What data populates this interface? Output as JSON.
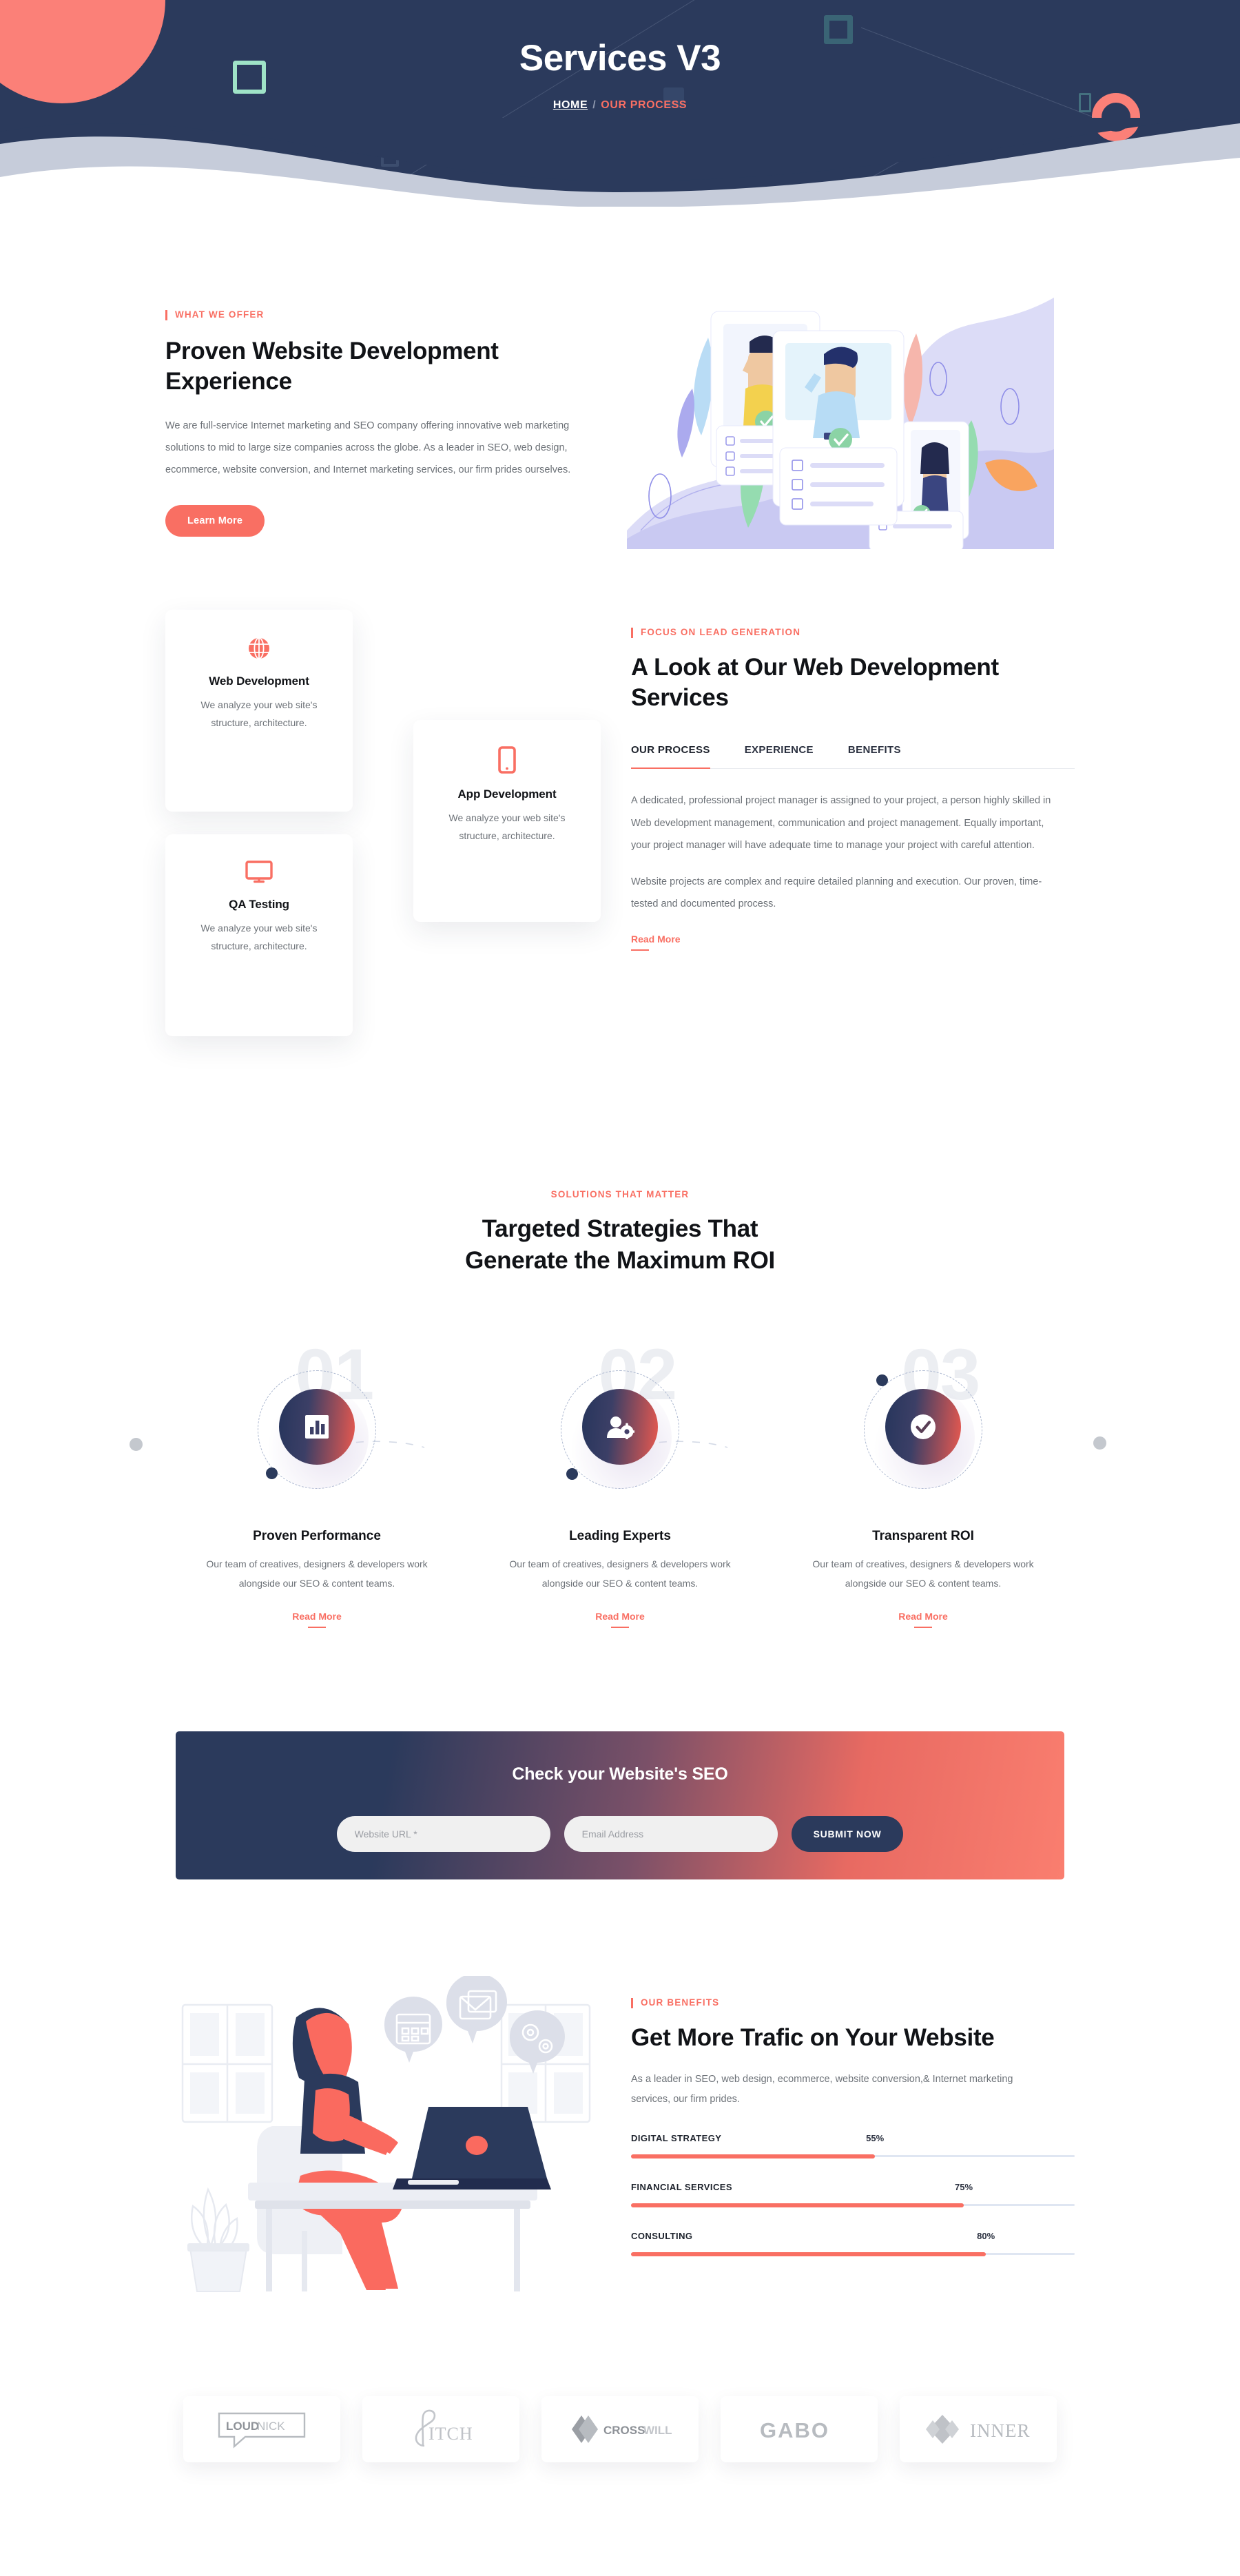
{
  "hero": {
    "title": "Services V3",
    "breadcrumb": {
      "home": "HOME",
      "separator": "/",
      "current": "OUR PROCESS"
    },
    "bg_color": "#2b3a5c",
    "accent_color": "#f96f63"
  },
  "offer": {
    "eyebrow": "WHAT WE OFFER",
    "title": "Proven Website Development Experience",
    "paragraph": "We are full-service Internet marketing and SEO company offering innovative web marketing solutions to mid to large size companies across the globe. As a leader in SEO, web design, ecommerce, website conversion, and Internet marketing services, our firm prides ourselves.",
    "button_label": "Learn More",
    "illustration_name": "profile-cards-illustration"
  },
  "services": {
    "cards": [
      {
        "icon": "globe-icon",
        "title": "Web Development",
        "text": "We analyze your web site's structure, architecture."
      },
      {
        "icon": "mobile-icon",
        "title": "App Development",
        "text": "We analyze your web site's structure, architecture."
      },
      {
        "icon": "monitor-icon",
        "title": "QA Testing",
        "text": "We analyze your web site's structure, architecture."
      }
    ],
    "eyebrow": "FOCUS ON LEAD GENERATION",
    "title": "A Look at Our Web Development Services",
    "tabs": [
      {
        "label": "OUR PROCESS",
        "active": true
      },
      {
        "label": "EXPERIENCE",
        "active": false
      },
      {
        "label": "BENEFITS",
        "active": false
      }
    ],
    "panel": {
      "paragraph1": "A dedicated, professional project manager is assigned to your project, a person highly skilled in Web development management, communication and project management. Equally important, your project manager will have adequate time to manage your project with careful attention.",
      "paragraph2": "Website projects are complex and require detailed planning and execution. Our proven, time-tested and documented process.",
      "read_more": "Read More"
    }
  },
  "steps_section": {
    "eyebrow": "SOLUTIONS THAT MATTER",
    "title_line1": "Targeted Strategies That",
    "title_line2": "Generate the Maximum ROI",
    "steps": [
      {
        "number": "01",
        "icon": "bar-chart-icon",
        "title": "Proven Performance",
        "text": "Our team of creatives, designers & developers work alongside our SEO & content teams.",
        "read_more": "Read More"
      },
      {
        "number": "02",
        "icon": "user-settings-icon",
        "title": "Leading Experts",
        "text": "Our team of creatives, designers & developers work alongside our SEO & content teams.",
        "read_more": "Read More"
      },
      {
        "number": "03",
        "icon": "check-circle-icon",
        "title": "Transparent ROI",
        "text": "Our team of creatives, designers & developers work alongside our SEO & content teams.",
        "read_more": "Read More"
      }
    ]
  },
  "seo_form": {
    "title": "Check your Website's SEO",
    "url_placeholder": "Website URL *",
    "email_placeholder": "Email Address",
    "url_value": "",
    "email_value": "",
    "submit_label": "SUBMIT NOW",
    "gradient_from": "#2b3a5c",
    "gradient_to": "#fa7e6f"
  },
  "benefits": {
    "eyebrow": "OUR BENEFITS",
    "title": "Get More Trafic on Your Website",
    "paragraph": "As a leader in SEO, web design, ecommerce, website conversion,& Internet marketing services, our firm prides.",
    "illustration_name": "woman-at-laptop-illustration",
    "chart_data": {
      "type": "bar",
      "categories": [
        "DIGITAL STRATEGY",
        "FINANCIAL SERVICES",
        "CONSULTING"
      ],
      "values": [
        55,
        75,
        80
      ],
      "value_labels": [
        "55%",
        "75%",
        "80%"
      ],
      "title": "Get More Trafic on Your Website",
      "xlabel": "",
      "ylabel": "",
      "ylim": [
        0,
        100
      ],
      "orientation": "horizontal",
      "grid": false,
      "legend": "none",
      "bar_color": "#f96f63",
      "track_color": "#dfe6f2"
    }
  },
  "logos": [
    {
      "name": "LOUDNICK",
      "part1": "LOUD",
      "part2": "NICK"
    },
    {
      "name": "PITCH",
      "part1": "",
      "part2": "ITCH"
    },
    {
      "name": "CROSSWILL",
      "part1": "CROSS",
      "part2": "WILL"
    },
    {
      "name": "GABO",
      "part1": "GABO",
      "part2": ""
    },
    {
      "name": "INNER",
      "part1": "INNER",
      "part2": ""
    }
  ]
}
